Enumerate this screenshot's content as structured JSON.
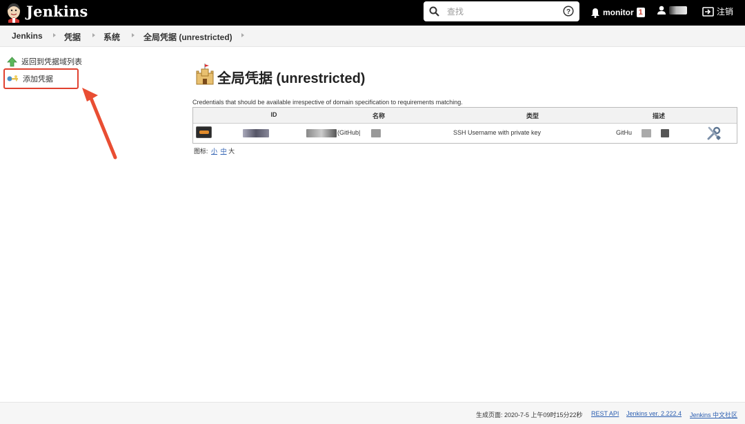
{
  "header": {
    "brand": "Jenkins",
    "search_placeholder": "查找",
    "monitor_label": "monitor",
    "monitor_count": "1",
    "logout_label": "注销"
  },
  "breadcrumb": [
    "Jenkins",
    "凭据",
    "系统",
    "全局凭据 (unrestricted)"
  ],
  "sidebar": {
    "items": [
      {
        "label": "返回到凭据域列表",
        "icon": "up-arrow-icon"
      },
      {
        "label": "添加凭据",
        "icon": "key-icon"
      }
    ]
  },
  "main": {
    "title": "全局凭据 (unrestricted)",
    "description": "Credentials that should be available irrespective of domain specification to requirements matching.",
    "table": {
      "columns": [
        "ID",
        "名称",
        "类型",
        "描述"
      ],
      "rows": [
        {
          "id": "",
          "name": "(GitHub|",
          "type": "SSH Username with private key",
          "description": "GitHu"
        }
      ]
    },
    "icon_size_label": "图标:",
    "icon_sizes": [
      "小",
      "中",
      "大"
    ]
  },
  "footer": {
    "generated": "生成页面: 2020-7-5 上午09时15分22秒",
    "rest_api": "REST API",
    "version": "Jenkins ver. 2.222.4",
    "community": "Jenkins 中文社区"
  },
  "colors": {
    "header_bg": "#000000",
    "highlight": "#e0402e",
    "link": "#2a5db0"
  }
}
